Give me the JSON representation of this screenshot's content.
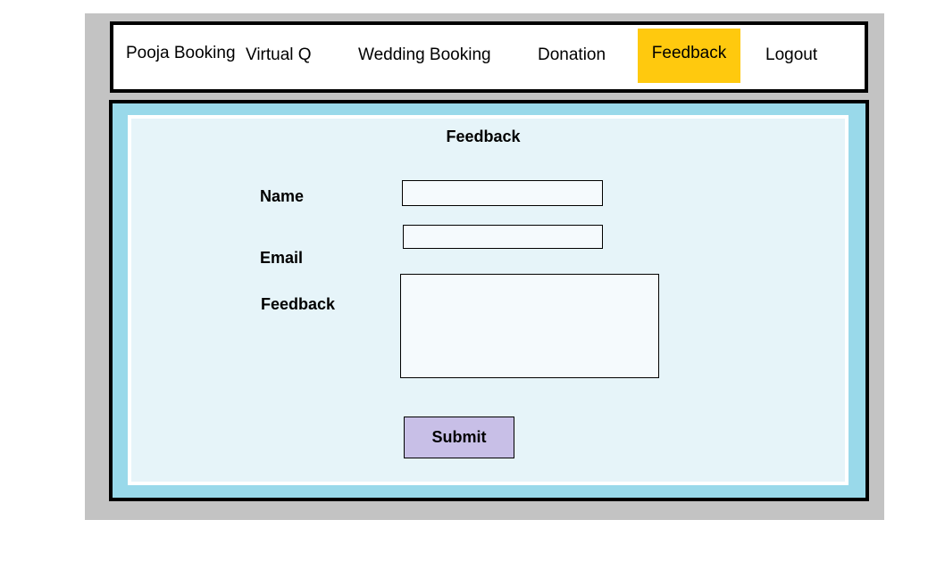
{
  "nav": {
    "items": [
      {
        "label": "Pooja Booking"
      },
      {
        "label": "Virtual Q"
      },
      {
        "label": "Wedding Booking"
      },
      {
        "label": "Donation"
      },
      {
        "label": "Feedback",
        "active": true
      },
      {
        "label": "Logout"
      }
    ],
    "active_color": "#ffc90e"
  },
  "form": {
    "title": "Feedback",
    "name_label": "Name",
    "name_value": "",
    "email_label": "Email",
    "email_value": "",
    "feedback_label": "Feedback",
    "feedback_value": "",
    "submit_label": "Submit"
  },
  "colors": {
    "frame": "#c3c3c3",
    "content_border": "#99d9ea",
    "content_bg": "#e6f4f9",
    "submit_bg": "#c8bfe7"
  }
}
